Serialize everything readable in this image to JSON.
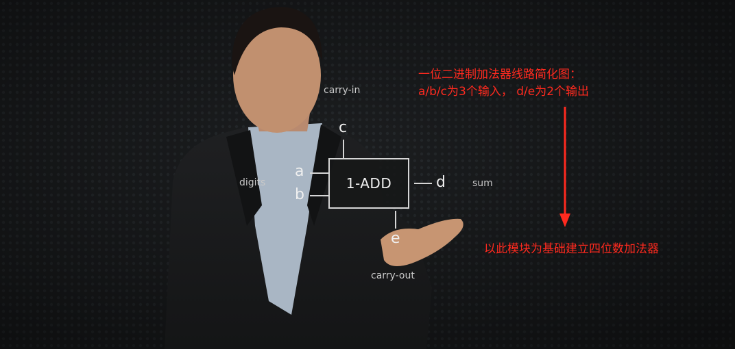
{
  "diagram": {
    "block_label": "1-ADD",
    "carry_in_label": "carry-in",
    "digits_label": "digits",
    "sum_label": "sum",
    "carry_out_label": "carry-out",
    "pins": {
      "a": "a",
      "b": "b",
      "c": "c",
      "d": "d",
      "e": "e"
    }
  },
  "annotation": {
    "line1": "一位二进制加法器线路简化图：",
    "line2": "a/b/c为3个输入，  d/e为2个输出",
    "bottom": "以此模块为基础建立四位数加法器",
    "color": "#ff2a1f"
  }
}
